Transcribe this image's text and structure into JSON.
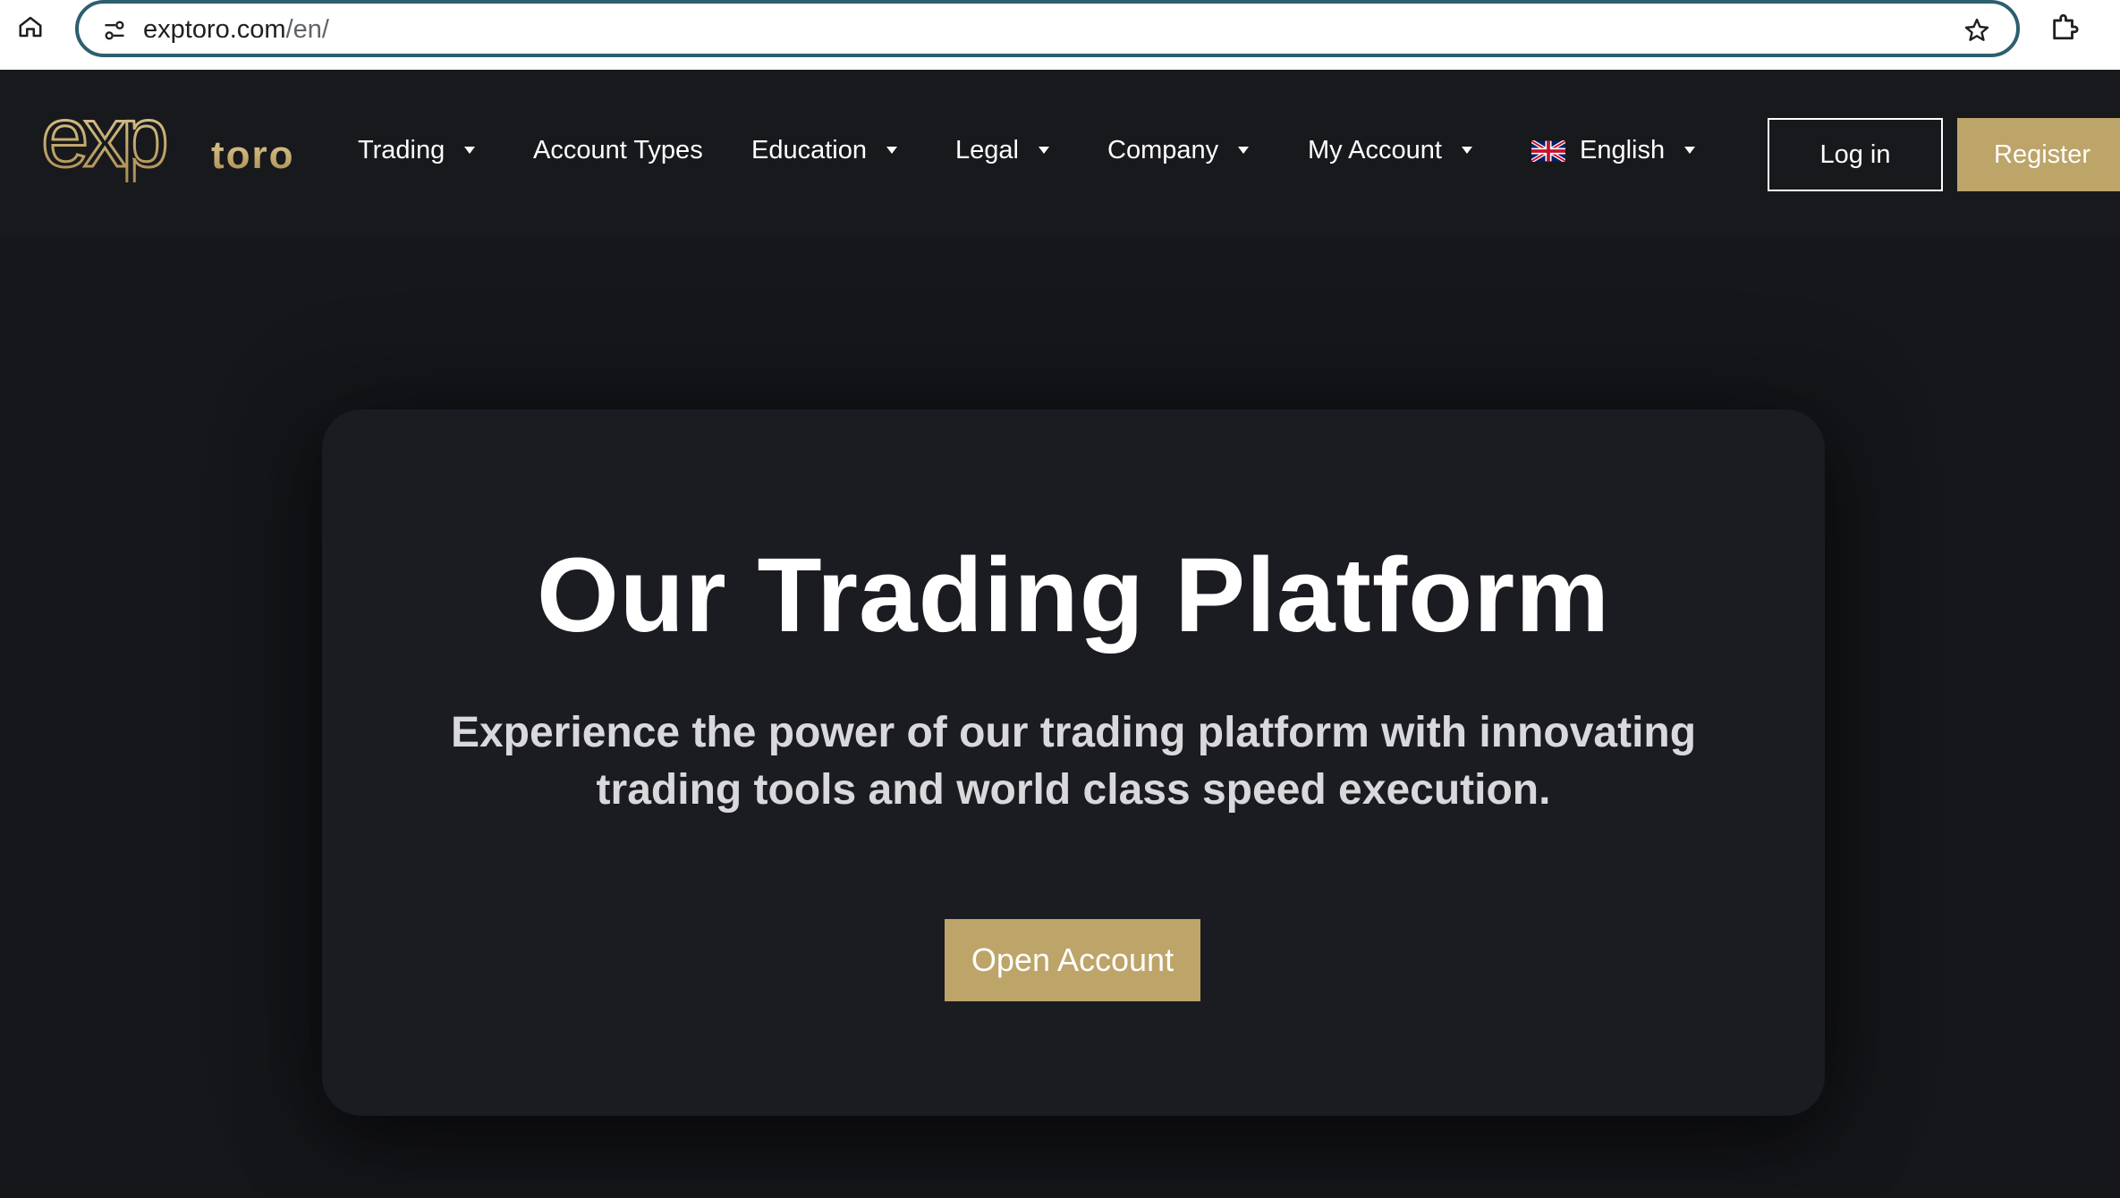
{
  "browser": {
    "url_host": "exptoro.com",
    "url_path": "/en/"
  },
  "brand": {
    "logo_mark": "exp",
    "logo_word": "toro",
    "gold": "#bda468"
  },
  "nav": {
    "items": [
      {
        "label": "Trading",
        "dropdown": true
      },
      {
        "label": "Account Types",
        "dropdown": false
      },
      {
        "label": "Education",
        "dropdown": true
      },
      {
        "label": "Legal",
        "dropdown": true
      },
      {
        "label": "Company",
        "dropdown": true
      },
      {
        "label": "My Account",
        "dropdown": true
      }
    ],
    "language": {
      "label": "English",
      "flag": "uk-flag-icon"
    },
    "login_label": "Log in",
    "register_label": "Register"
  },
  "hero": {
    "title": "Our Trading Platform",
    "subtitle": "Experience the power of our trading platform with innovating trading tools and world class speed execution.",
    "cta_label": "Open Account"
  }
}
